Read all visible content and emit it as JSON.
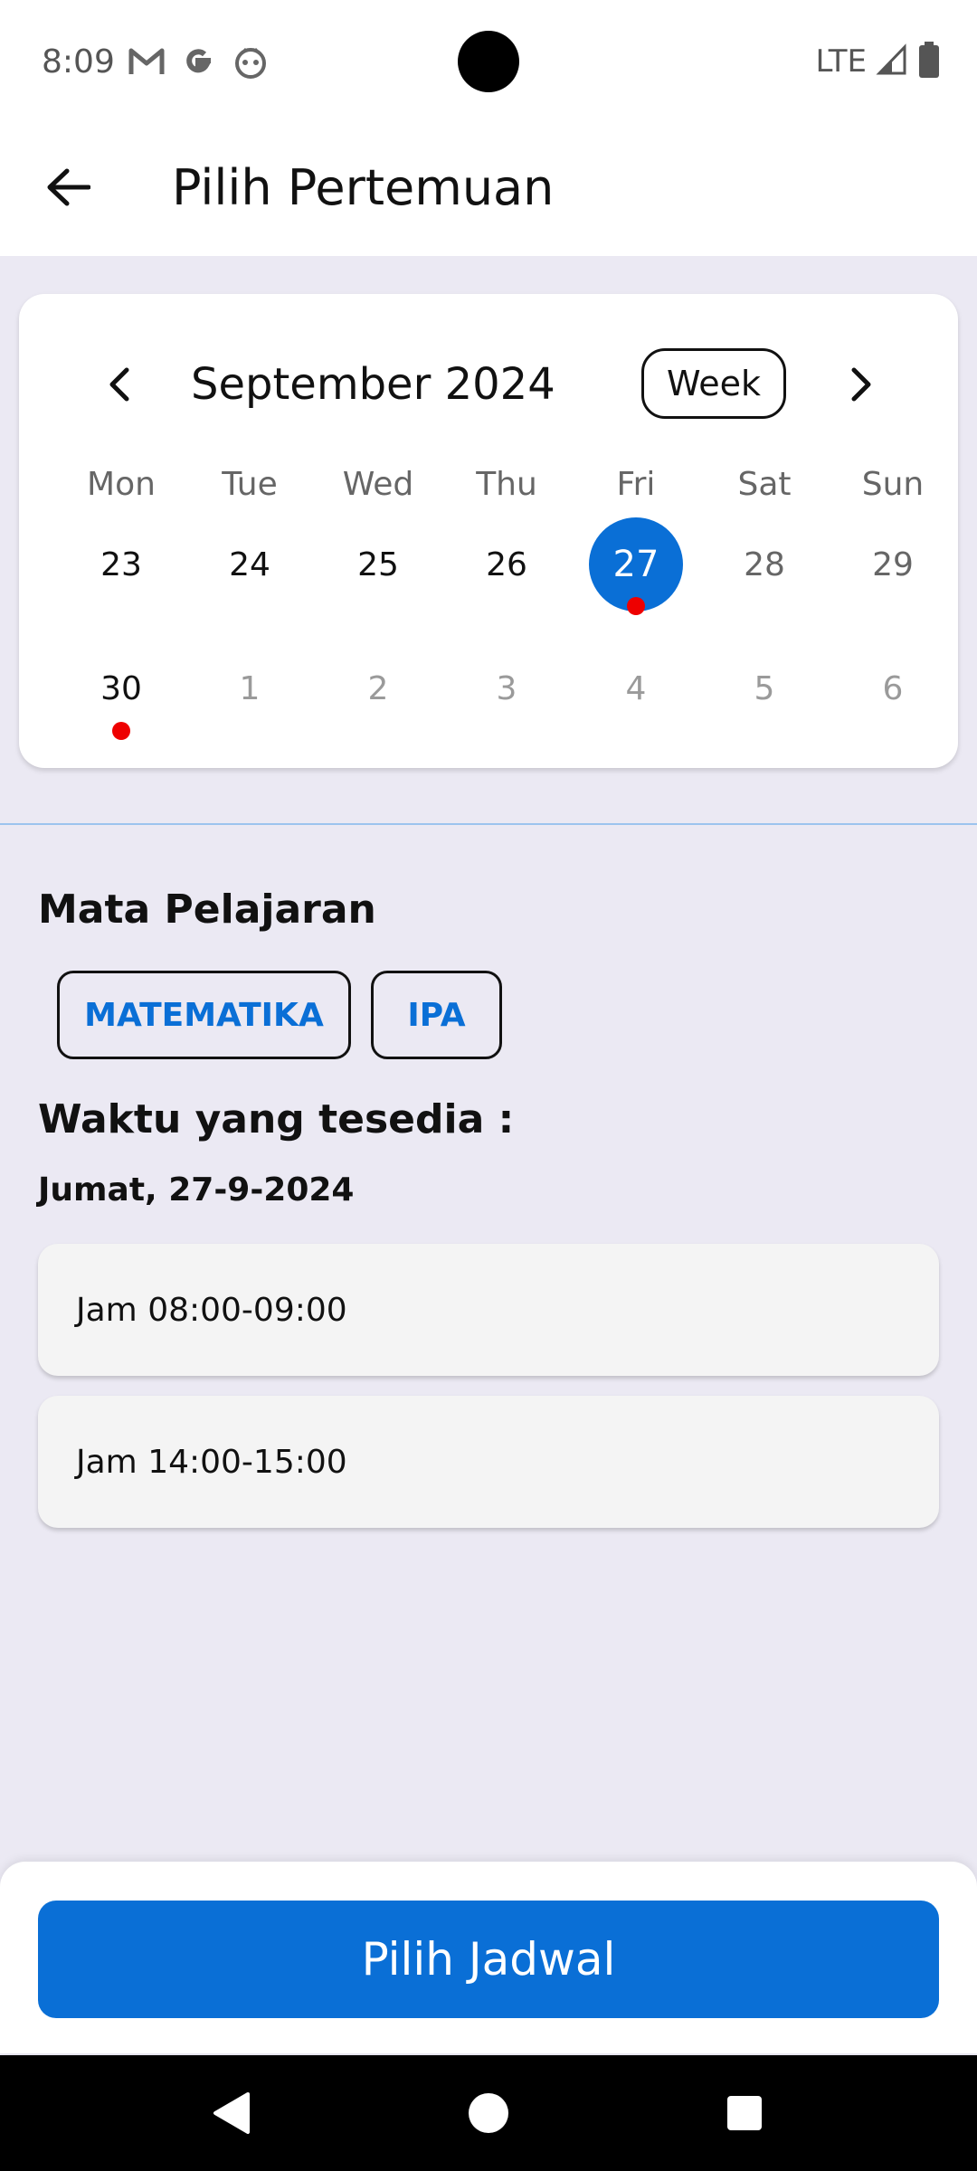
{
  "status_bar": {
    "time": "8:09",
    "network": "LTE",
    "icons": [
      "gmail-icon",
      "google-icon",
      "app-icon",
      "signal-icon",
      "battery-icon"
    ]
  },
  "app_bar": {
    "title": "Pilih Pertemuan",
    "back_icon": "arrow-back-icon"
  },
  "calendar": {
    "month_label": "September 2024",
    "format_button": "Week",
    "weekdays": [
      "Mon",
      "Tue",
      "Wed",
      "Thu",
      "Fri",
      "Sat",
      "Sun"
    ],
    "week1": [
      "23",
      "24",
      "25",
      "26",
      "27",
      "28",
      "29"
    ],
    "week2": [
      "30",
      "1",
      "2",
      "3",
      "4",
      "5",
      "6"
    ],
    "selected_day": "27",
    "event_days": [
      "27",
      "30"
    ],
    "selected_color": "#0a6fd6",
    "event_color": "#ee0000"
  },
  "subjects": {
    "title": "Mata Pelajaran",
    "chips": [
      "MATEMATIKA",
      "IPA"
    ]
  },
  "times": {
    "title": "Waktu yang tesedia :",
    "date": "Jumat, 27-9-2024",
    "slots": [
      "Jam 08:00-09:00",
      "Jam 14:00-15:00"
    ]
  },
  "footer": {
    "button_label": "Pilih Jadwal",
    "accent": "#0a6fd6"
  }
}
